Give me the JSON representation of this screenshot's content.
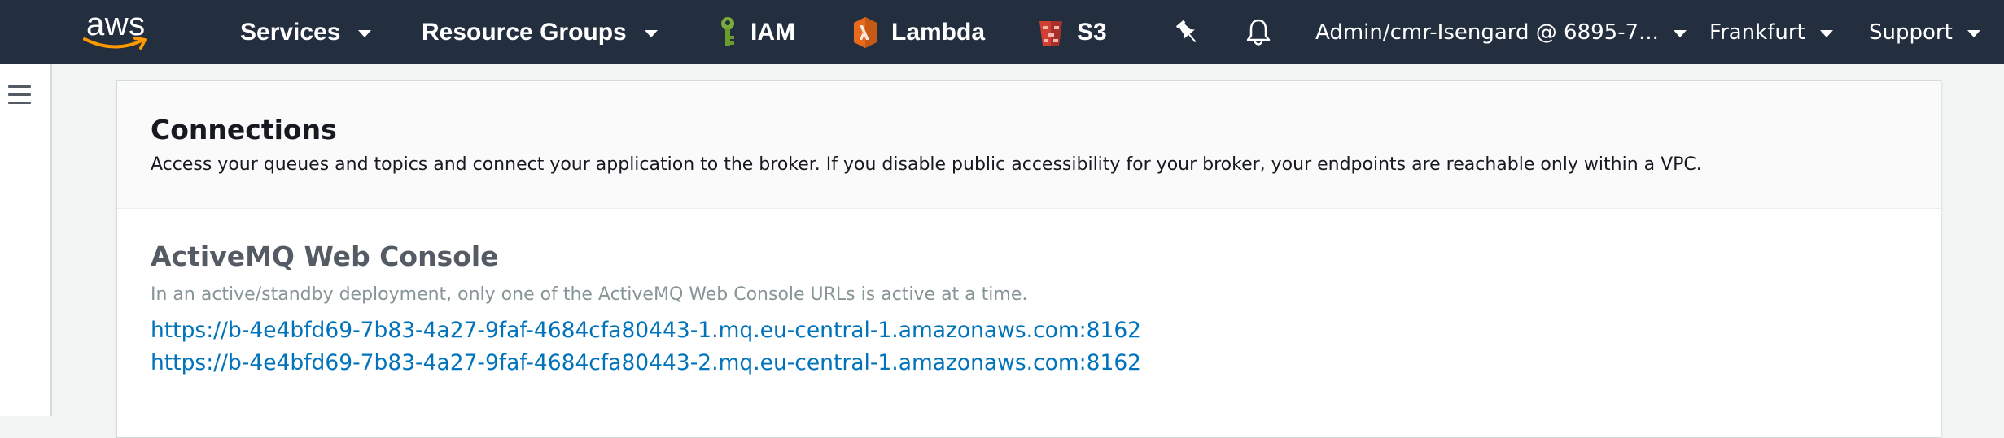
{
  "nav": {
    "logo": "aws",
    "services": "Services",
    "resource_groups": "Resource Groups",
    "pinned": [
      {
        "label": "IAM",
        "icon": "iam-key-icon",
        "color": "#6a9b2f"
      },
      {
        "label": "Lambda",
        "icon": "lambda-icon",
        "color": "#e8691c"
      },
      {
        "label": "S3",
        "icon": "s3-bucket-icon",
        "color": "#d13e32"
      }
    ],
    "account": "Admin/cmr-Isengard @ 6895-7...",
    "region": "Frankfurt",
    "support": "Support",
    "colors": {
      "background": "#232f3e",
      "smile": "#ff9900"
    }
  },
  "main": {
    "title": "Connections",
    "description": "Access your queues and topics and connect your application to the broker. If you disable public accessibility for your broker, your endpoints are reachable only within a VPC.",
    "section": {
      "title": "ActiveMQ Web Console",
      "note": "In an active/standby deployment, only one of the ActiveMQ Web Console URLs is active at a time.",
      "urls": [
        "https://b-4e4bfd69-7b83-4a27-9faf-4684cfa80443-1.mq.eu-central-1.amazonaws.com:8162",
        "https://b-4e4bfd69-7b83-4a27-9faf-4684cfa80443-2.mq.eu-central-1.amazonaws.com:8162"
      ]
    },
    "colors": {
      "link": "#0073bb"
    }
  }
}
